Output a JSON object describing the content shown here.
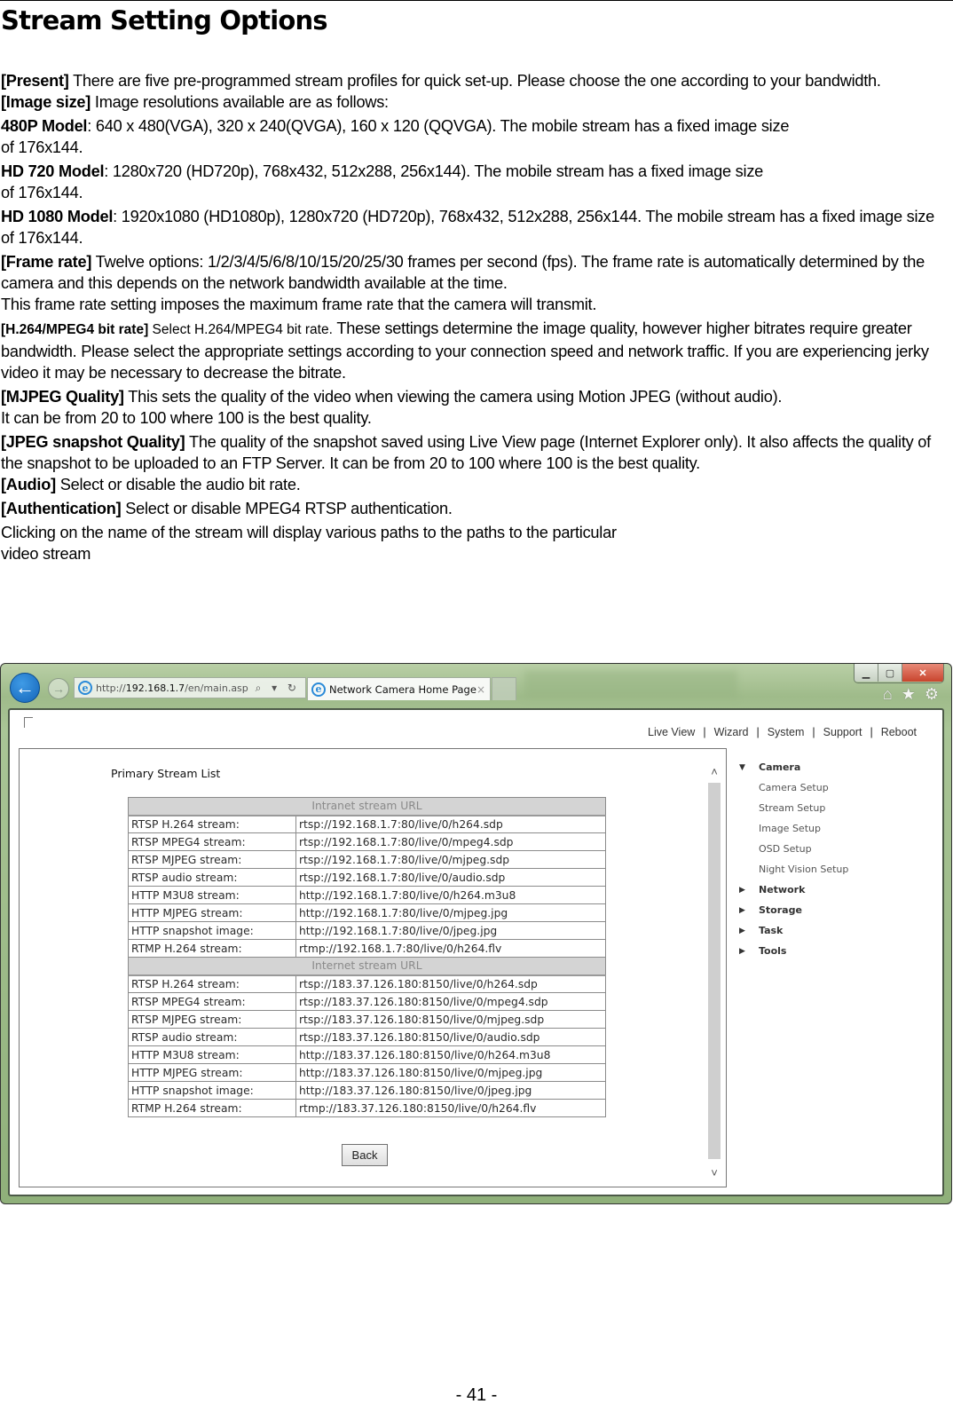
{
  "document": {
    "title": "Stream Setting Options",
    "paragraphs": {
      "present": {
        "label": "[Present]",
        "text": " There are five pre-programmed stream profiles for quick set-up. Please choose the one according to your bandwidth."
      },
      "image_size": {
        "label": "[Image size]",
        "text": " Image resolutions available are as follows:"
      },
      "model_480p": {
        "label": "480P Model",
        "text": ": 640 x 480(VGA), 320 x 240(QVGA), 160 x 120 (QQVGA). The mobile stream has a fixed image size",
        "text2": "of 176x144."
      },
      "model_720": {
        "label": "HD 720 Model",
        "text": ": 1280x720 (HD720p), 768x432, 512x288, 256x144). The mobile stream has a fixed image size",
        "text2": "of 176x144."
      },
      "model_1080": {
        "label": "HD 1080 Model",
        "text": ": 1920x1080 (HD1080p), 1280x720 (HD720p), 768x432, 512x288, 256x144. The mobile stream has a fixed image size of 176x144."
      },
      "frame_rate": {
        "label": "[Frame rate]",
        "text": " Twelve options: 1/2/3/4/5/6/8/10/15/20/25/30 frames per second (fps). The frame rate is automatically determined by the camera and this depends on the network bandwidth available at the time.",
        "text2": "This frame rate setting imposes the maximum frame rate that the camera will transmit."
      },
      "bitrate": {
        "label": "[H.264/MPEG4 bit rate]",
        "label_suffix": " Select H.264/MPEG4 bit rate.",
        "text": " These settings determine the image quality, however higher bitrates require greater bandwidth. Please select the appropriate settings according to your connection speed and network traffic. If you are experiencing jerky video it may be necessary to decrease the bitrate."
      },
      "mjpeg_quality": {
        "label": "[MJPEG Quality]",
        "text": " This sets the quality of the video when viewing the camera using Motion JPEG (without audio).",
        "text2": "It can be from 20 to 100 where 100 is the best quality."
      },
      "jpeg_snapshot": {
        "label": "[JPEG snapshot Quality]",
        "text": " The quality of the snapshot saved using Live View page (Internet Explorer only). It also affects the quality of the snapshot to be uploaded to an FTP Server. It can be from 20 to 100 where 100 is the best quality."
      },
      "audio": {
        "label": "[Audio]",
        "text": " Select or disable the audio bit rate."
      },
      "authentication": {
        "label": "[Authentication]",
        "text": " Select or disable MPEG4 RTSP authentication."
      },
      "clicking": {
        "text": "Clicking on the name of the stream will display various paths to the paths to the particular",
        "text2": "video stream"
      }
    },
    "page_number": "- 41 -"
  },
  "browser": {
    "address": {
      "prefix": "http://",
      "host": "192.168.1.7",
      "path": "/en/main.asp",
      "tools": "⌕ ▾ ↻"
    },
    "tab_title": "Network Camera Home Page",
    "tab_close": "×",
    "window_controls": {
      "minimize": "▁",
      "maximize": "▢",
      "close": "✕"
    },
    "toolbar_icons": {
      "home": "⌂",
      "favorites": "★",
      "settings": "⚙"
    },
    "nav": {
      "back": "←",
      "forward": "→"
    },
    "top_links": [
      "Live View",
      "Wizard",
      "System",
      "Support",
      "Reboot"
    ],
    "top_link_separator": "|",
    "stream_list": {
      "heading": "Primary Stream List",
      "sections": [
        {
          "title": "Intranet stream URL",
          "rows": [
            {
              "label": "RTSP H.264 stream:",
              "url": "rtsp://192.168.1.7:80/live/0/h264.sdp"
            },
            {
              "label": "RTSP MPEG4 stream:",
              "url": "rtsp://192.168.1.7:80/live/0/mpeg4.sdp"
            },
            {
              "label": "RTSP MJPEG stream:",
              "url": "rtsp://192.168.1.7:80/live/0/mjpeg.sdp"
            },
            {
              "label": "RTSP audio stream:",
              "url": "rtsp://192.168.1.7:80/live/0/audio.sdp"
            },
            {
              "label": "HTTP M3U8 stream:",
              "url": "http://192.168.1.7:80/live/0/h264.m3u8"
            },
            {
              "label": "HTTP MJPEG stream:",
              "url": "http://192.168.1.7:80/live/0/mjpeg.jpg"
            },
            {
              "label": "HTTP snapshot image:",
              "url": "http://192.168.1.7:80/live/0/jpeg.jpg"
            },
            {
              "label": "RTMP H.264 stream:",
              "url": "rtmp://192.168.1.7:80/live/0/h264.flv"
            }
          ]
        },
        {
          "title": "Internet stream URL",
          "rows": [
            {
              "label": "RTSP H.264 stream:",
              "url": "rtsp://183.37.126.180:8150/live/0/h264.sdp"
            },
            {
              "label": "RTSP MPEG4 stream:",
              "url": "rtsp://183.37.126.180:8150/live/0/mpeg4.sdp"
            },
            {
              "label": "RTSP MJPEG stream:",
              "url": "rtsp://183.37.126.180:8150/live/0/mjpeg.sdp"
            },
            {
              "label": "RTSP audio stream:",
              "url": "rtsp://183.37.126.180:8150/live/0/audio.sdp"
            },
            {
              "label": "HTTP M3U8 stream:",
              "url": "http://183.37.126.180:8150/live/0/h264.m3u8"
            },
            {
              "label": "HTTP MJPEG stream:",
              "url": "http://183.37.126.180:8150/live/0/mjpeg.jpg"
            },
            {
              "label": "HTTP snapshot image:",
              "url": "http://183.37.126.180:8150/live/0/jpeg.jpg"
            },
            {
              "label": "RTMP H.264 stream:",
              "url": "rtmp://183.37.126.180:8150/live/0/h264.flv"
            }
          ]
        }
      ],
      "back_button": "Back"
    },
    "scroll": {
      "up": "˄",
      "down": "˅"
    },
    "side_menu": {
      "groups": [
        {
          "label": "Camera",
          "expanded": true,
          "arrow": "▼",
          "items": [
            "Camera Setup",
            "Stream Setup",
            "Image Setup",
            "OSD Setup",
            "Night Vision Setup"
          ]
        },
        {
          "label": "Network",
          "expanded": false,
          "arrow": "▶",
          "items": []
        },
        {
          "label": "Storage",
          "expanded": false,
          "arrow": "▶",
          "items": []
        },
        {
          "label": "Task",
          "expanded": false,
          "arrow": "▶",
          "items": []
        },
        {
          "label": "Tools",
          "expanded": false,
          "arrow": "▶",
          "items": []
        }
      ]
    }
  }
}
